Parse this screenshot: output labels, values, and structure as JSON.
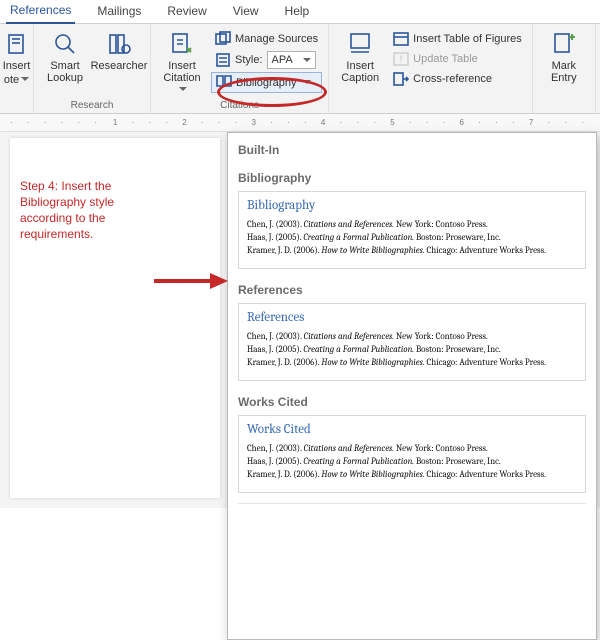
{
  "tabs": [
    "References",
    "Mailings",
    "Review",
    "View",
    "Help"
  ],
  "selected_tab": 0,
  "ribbon": {
    "insert": {
      "label_top": "Insert",
      "label_bot": "ote",
      "drop": true
    },
    "research": {
      "smart_lookup": "Smart\nLookup",
      "researcher": "Researcher",
      "group_label": "Research"
    },
    "citations": {
      "insert_citation": "Insert\nCitation",
      "manage_sources": "Manage Sources",
      "style_label": "Style:",
      "style_value": "APA",
      "bibliography": "Bibliography",
      "group_label": "Citations"
    },
    "captions": {
      "insert_caption": "Insert\nCaption",
      "table_figures": "Insert Table of Figures",
      "update_table": "Update Table",
      "cross_ref": "Cross-reference"
    },
    "index": {
      "mark_entry": "Mark\nEntry"
    }
  },
  "ruler_left": "· · · · · ·",
  "ruler_right": "1 · · · 2 · · · 3 · · · 4 · · · 5 · · · 6 · · · 7 · · ·",
  "instruction": "Step 4: Insert the Bibliography style according to the requirements.",
  "gallery": {
    "builtin_label": "Built-In",
    "sections": [
      {
        "heading": "Bibliography",
        "title": "Bibliography"
      },
      {
        "heading": "References",
        "title": "References"
      },
      {
        "heading": "Works Cited",
        "title": "Works Cited"
      }
    ],
    "entries": [
      {
        "author": "Chen, J. (2003). ",
        "work": "Citations and References.",
        "pub": " New York: Contoso Press."
      },
      {
        "author": "Haas, J. (2005). ",
        "work": "Creating a Formal Publication.",
        "pub": " Boston: Proseware, Inc."
      },
      {
        "author": "Kramer, J. D. (2006). ",
        "work": "How to Write Bibliographies.",
        "pub": " Chicago: Adventure Works Press."
      }
    ]
  }
}
